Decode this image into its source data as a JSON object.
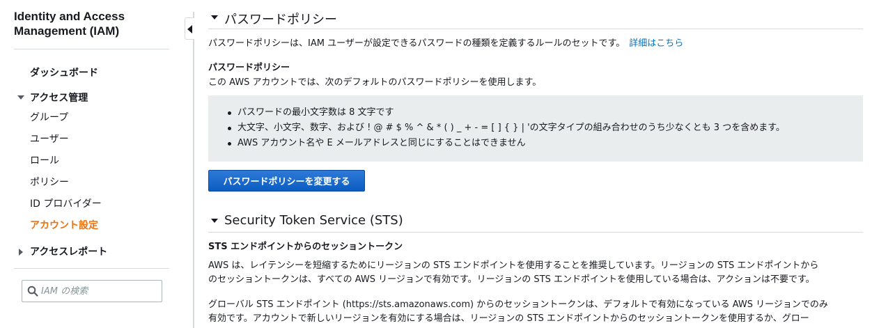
{
  "sidebar": {
    "title": "Identity and Access Management (IAM)",
    "dashboard": "ダッシュボード",
    "access_management": "アクセス管理",
    "items": [
      "グループ",
      "ユーザー",
      "ロール",
      "ポリシー",
      "ID プロバイダー",
      "アカウント設定"
    ],
    "active_item": "アカウント設定",
    "access_reports": "アクセスレポート",
    "search_placeholder": "IAM の検索",
    "search_icon": "search-icon",
    "accent_color": "#ec7211"
  },
  "password_policy": {
    "section_title": "パスワードポリシー",
    "description": "パスワードポリシーは、IAM ユーザーが設定できるパスワードの種類を定義するルールのセットです。",
    "learn_more": "詳細はこちら",
    "subheading": "パスワードポリシー",
    "default_text": "この AWS アカウントでは、次のデフォルトのパスワードポリシーを使用します。",
    "rules": [
      "パスワードの最小文字数は 8 文字です",
      "大文字、小文字、数字、および ! @ # $ % ^ & * ( ) _ + - = [ ] { } | 'の文字タイプの組み合わせのうち少なくとも 3 つを含めます。",
      "AWS アカウント名や E メールアドレスと同じにすることはできません"
    ],
    "change_button": "パスワードポリシーを変更する",
    "button_color": "#0a5ec6"
  },
  "sts": {
    "section_title": "Security Token Service (STS)",
    "subheading": "STS エンドポイントからのセッショントークン",
    "para1_line1": "AWS は、レイテンシーを短縮するためにリージョンの STS エンドポイントを使用することを推奨しています。リージョンの STS エンドポイントから",
    "para1_line2": "のセッショントークンは、すべての AWS リージョンで有効です。リージョンの STS エンドポイントを使用している場合は、アクションは不要です。",
    "para2_line1": "グローバル STS エンドポイント (https://sts.amazonaws.com) からのセッショントークンは、デフォルトで有効になっている AWS リージョンでのみ",
    "para2_line2": "有効です。アカウントで新しいリージョンを有効にする場合は、リージョンの STS エンドポイントからのセッショントークンを使用するか、グロー"
  }
}
